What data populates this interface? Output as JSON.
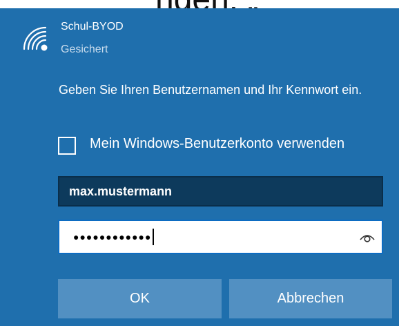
{
  "top_caption": "ngen: „",
  "network": {
    "name": "Schul-BYOD",
    "status": "Gesichert",
    "icon": "wifi-secured-icon"
  },
  "instruction": "Geben Sie Ihren Benutzernamen und Ihr Kennwort ein.",
  "checkbox": {
    "label": "Mein Windows-Benutzerkonto verwenden",
    "checked": false
  },
  "username": {
    "value": "max.mustermann"
  },
  "password": {
    "masked_value": "●●●●●●●●●●●●",
    "reveal_icon": "eye-icon"
  },
  "buttons": {
    "ok": "OK",
    "cancel": "Abbrechen"
  },
  "colors": {
    "panel_bg": "#1f6fad",
    "username_bg": "#0d3a5c",
    "button_bg": "#5290c2",
    "password_border": "#0d6cc2"
  }
}
